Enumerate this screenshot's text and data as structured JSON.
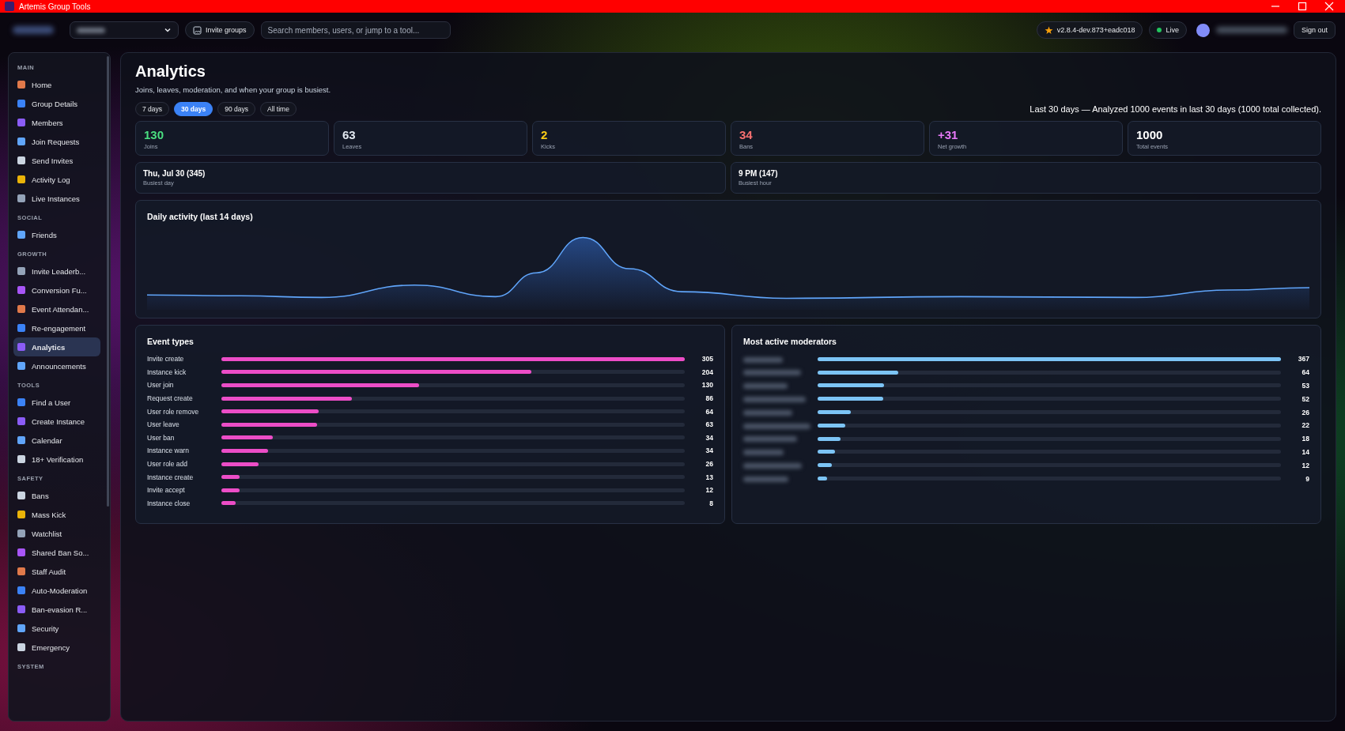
{
  "window": {
    "title": "Artemis Group Tools"
  },
  "topbar": {
    "invite_button": "Invite groups",
    "search": {
      "placeholder": "Search members, users, or jump to a tool..."
    },
    "version": "v2.8.4-dev.873+eadc018",
    "live": "Live",
    "sign_out": "Sign out"
  },
  "sidebar": {
    "sections": [
      {
        "title": "MAIN",
        "items": [
          {
            "label": "Home",
            "selected": false
          },
          {
            "label": "Group Details",
            "selected": false
          },
          {
            "label": "Members",
            "selected": false
          },
          {
            "label": "Join Requests",
            "selected": false
          },
          {
            "label": "Send Invites",
            "selected": false
          },
          {
            "label": "Activity Log",
            "selected": false
          },
          {
            "label": "Live Instances",
            "selected": false
          }
        ]
      },
      {
        "title": "SOCIAL",
        "items": [
          {
            "label": "Friends",
            "selected": false
          }
        ]
      },
      {
        "title": "GROWTH",
        "items": [
          {
            "label": "Invite Leaderb...",
            "selected": false
          },
          {
            "label": "Conversion Fu...",
            "selected": false
          },
          {
            "label": "Event Attendan...",
            "selected": false
          },
          {
            "label": "Re-engagement",
            "selected": false
          },
          {
            "label": "Analytics",
            "selected": true
          },
          {
            "label": "Announcements",
            "selected": false
          }
        ]
      },
      {
        "title": "TOOLS",
        "items": [
          {
            "label": "Find a User",
            "selected": false
          },
          {
            "label": "Create Instance",
            "selected": false
          },
          {
            "label": "Calendar",
            "selected": false
          },
          {
            "label": "18+ Verification",
            "selected": false
          }
        ]
      },
      {
        "title": "SAFETY",
        "items": [
          {
            "label": "Bans",
            "selected": false
          },
          {
            "label": "Mass Kick",
            "selected": false
          },
          {
            "label": "Watchlist",
            "selected": false
          },
          {
            "label": "Shared Ban So...",
            "selected": false
          },
          {
            "label": "Staff Audit",
            "selected": false
          },
          {
            "label": "Auto-Moderation",
            "selected": false
          },
          {
            "label": "Ban-evasion R...",
            "selected": false
          },
          {
            "label": "Security",
            "selected": false
          },
          {
            "label": "Emergency",
            "selected": false
          }
        ]
      },
      {
        "title": "SYSTEM"
      }
    ]
  },
  "page": {
    "title": "Analytics",
    "subtitle": "Joins, leaves, moderation, and when your group is busiest.",
    "ranges": [
      {
        "label": "7 days",
        "selected": false
      },
      {
        "label": "30 days",
        "selected": true
      },
      {
        "label": "90 days",
        "selected": false
      },
      {
        "label": "All time",
        "selected": false
      }
    ],
    "summary": "Last 30 days — Analyzed 1000 events in last 30 days (1000 total collected).",
    "stats": [
      {
        "value": "130",
        "label": "Joins",
        "color": "#4ade80"
      },
      {
        "value": "63",
        "label": "Leaves",
        "color": "#e2e8f0"
      },
      {
        "value": "2",
        "label": "Kicks",
        "color": "#facc15"
      },
      {
        "value": "34",
        "label": "Bans",
        "color": "#f87171"
      },
      {
        "value": "+31",
        "label": "Net growth",
        "color": "#e879f9"
      },
      {
        "value": "1000",
        "label": "Total events",
        "color": "#ffffff"
      }
    ],
    "busiest": [
      {
        "value": "Thu, Jul 30 (345)",
        "label": "Busiest day"
      },
      {
        "value": "9 PM (147)",
        "label": "Busiest hour"
      }
    ],
    "daily_activity": {
      "title": "Daily activity (last 14 days)"
    },
    "event_types": {
      "title": "Event types",
      "rows": [
        {
          "label": "Invite create",
          "count": "305",
          "level": 1.0
        },
        {
          "label": "Instance kick",
          "count": "204",
          "level": 0.669
        },
        {
          "label": "User join",
          "count": "130",
          "level": 0.426
        },
        {
          "label": "Request create",
          "count": "86",
          "level": 0.282
        },
        {
          "label": "User role remove",
          "count": "64",
          "level": 0.21
        },
        {
          "label": "User leave",
          "count": "63",
          "level": 0.207
        },
        {
          "label": "User ban",
          "count": "34",
          "level": 0.111
        },
        {
          "label": "Instance warn",
          "count": "34",
          "level": 0.1
        },
        {
          "label": "User role add",
          "count": "26",
          "level": 0.08
        },
        {
          "label": "Instance create",
          "count": "13",
          "level": 0.04
        },
        {
          "label": "Invite accept",
          "count": "12",
          "level": 0.04
        },
        {
          "label": "Instance close",
          "count": "8",
          "level": 0.03
        }
      ]
    },
    "moderators": {
      "title": "Most active moderators",
      "rows": [
        {
          "count": "367",
          "level": 1.0
        },
        {
          "count": "64",
          "level": 0.174
        },
        {
          "count": "53",
          "level": 0.144
        },
        {
          "count": "52",
          "level": 0.142
        },
        {
          "count": "26",
          "level": 0.071
        },
        {
          "count": "22",
          "level": 0.06
        },
        {
          "count": "18",
          "level": 0.049
        },
        {
          "count": "14",
          "level": 0.038
        },
        {
          "count": "12",
          "level": 0.03
        },
        {
          "count": "9",
          "level": 0.021
        }
      ]
    }
  }
}
